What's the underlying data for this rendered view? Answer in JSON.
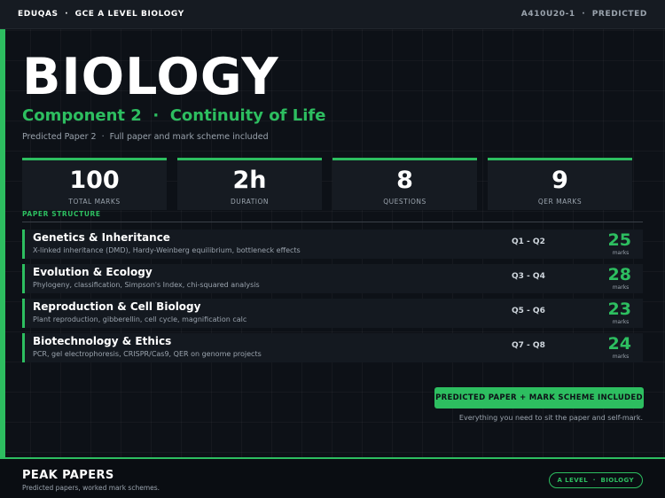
{
  "header": {
    "left": "EDUQAS  ·  GCE A LEVEL BIOLOGY",
    "right": "A410U20-1  ·  PREDICTED"
  },
  "hero": {
    "title": "BIOLOGY",
    "subtitle": "Component 2  ·  Continuity of Life",
    "description": "Predicted Paper 2  ·  Full paper and mark scheme included"
  },
  "stats": [
    {
      "value": "100",
      "label": "TOTAL MARKS"
    },
    {
      "value": "2h",
      "label": "DURATION"
    },
    {
      "value": "8",
      "label": "QUESTIONS"
    },
    {
      "value": "9",
      "label": "QER MARKS"
    }
  ],
  "structure": {
    "label": "PAPER STRUCTURE",
    "rows": [
      {
        "title": "Genetics & Inheritance",
        "desc": "X-linked inheritance (DMD), Hardy-Weinberg equilibrium, bottleneck effects",
        "questions": "Q1 - Q2",
        "marks": "25",
        "unit": "marks"
      },
      {
        "title": "Evolution & Ecology",
        "desc": "Phylogeny, classification, Simpson's Index, chi-squared analysis",
        "questions": "Q3 - Q4",
        "marks": "28",
        "unit": "marks"
      },
      {
        "title": "Reproduction & Cell Biology",
        "desc": "Plant reproduction, gibberellin, cell cycle, magnification calc",
        "questions": "Q5 - Q6",
        "marks": "23",
        "unit": "marks"
      },
      {
        "title": "Biotechnology & Ethics",
        "desc": "PCR, gel electrophoresis, CRISPR/Cas9, QER on genome projects",
        "questions": "Q7 - Q8",
        "marks": "24",
        "unit": "marks"
      }
    ]
  },
  "cta": {
    "label": "PREDICTED PAPER + MARK SCHEME INCLUDED",
    "note": "Everything you need to sit the paper and self-mark."
  },
  "footer": {
    "brand": "PEAK PAPERS",
    "tagline": "Predicted papers, worked mark schemes.",
    "pill": "A LEVEL  ·  BIOLOGY"
  },
  "colors": {
    "accent": "#2dbe60",
    "background": "#0d1117",
    "panel": "#161b22"
  }
}
